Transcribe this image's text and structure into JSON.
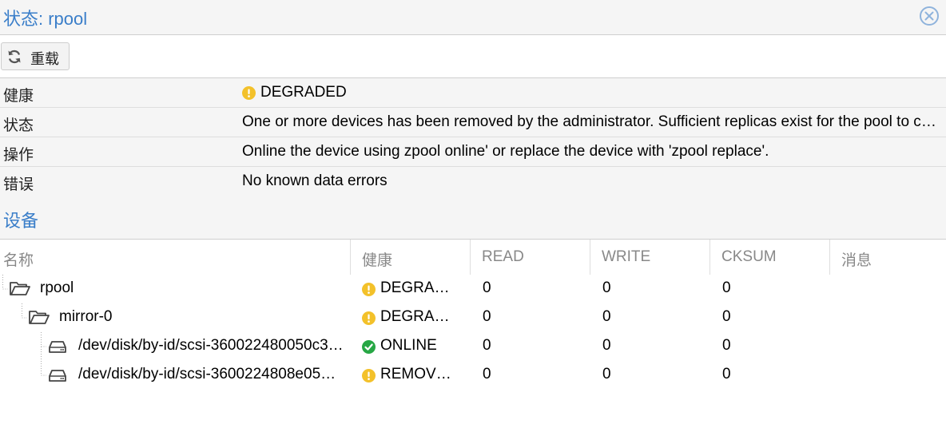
{
  "window": {
    "title": "状态: rpool",
    "close_icon": "close-circle-icon"
  },
  "toolbar": {
    "reload_label": "重载",
    "reload_icon": "refresh-icon"
  },
  "status": {
    "health_key": "健康",
    "health_value": "DEGRADED",
    "health_icon": "warning-circle-icon",
    "state_key": "状态",
    "state_value": "One or more devices has been removed by the administrator. Sufficient replicas exist for the pool to continue functioning in a degraded state.",
    "action_key": "操作",
    "action_value": "Online the device using zpool online' or replace the device with 'zpool replace'.",
    "errors_key": "错误",
    "errors_value": "No known data errors"
  },
  "devices": {
    "section_title": "设备",
    "columns": [
      "名称",
      "健康",
      "READ",
      "WRITE",
      "CKSUM",
      "消息"
    ],
    "rows": [
      {
        "name": "rpool",
        "health": "DEGRADED",
        "read": "0",
        "write": "0",
        "cksum": "0",
        "msg": "",
        "icon": "folder-open-icon",
        "status_icon": "warning-circle-icon"
      },
      {
        "name": "mirror-0",
        "health": "DEGRADED",
        "read": "0",
        "write": "0",
        "cksum": "0",
        "msg": "",
        "icon": "folder-open-icon",
        "status_icon": "warning-circle-icon"
      },
      {
        "name": "/dev/disk/by-id/scsi-360022480050c3…",
        "health": "ONLINE",
        "read": "0",
        "write": "0",
        "cksum": "0",
        "msg": "",
        "icon": "hard-drive-icon",
        "status_icon": "check-circle-icon"
      },
      {
        "name": "/dev/disk/by-id/scsi-3600224808e05…",
        "health": "REMOVED",
        "read": "0",
        "write": "0",
        "cksum": "0",
        "msg": "",
        "icon": "hard-drive-icon",
        "status_icon": "warning-circle-icon"
      }
    ]
  },
  "colors": {
    "accent": "#3a7ec9",
    "warning": "#f3c12a",
    "ok": "#27a745"
  }
}
